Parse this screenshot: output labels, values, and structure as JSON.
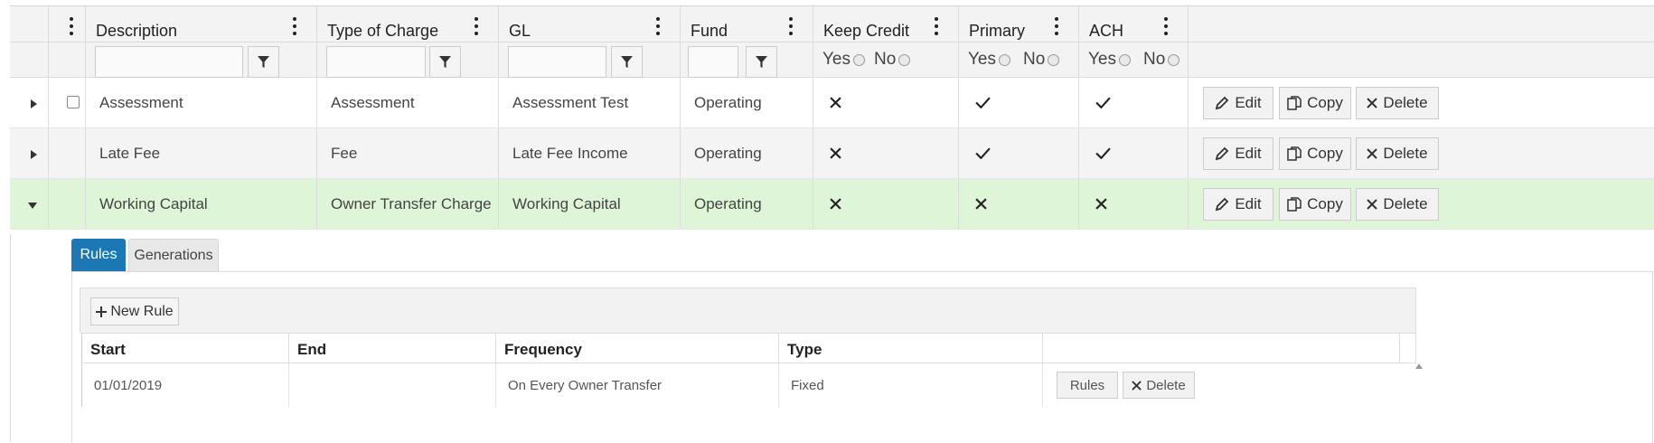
{
  "grid": {
    "headers": {
      "description": "Description",
      "type_of_charge": "Type of Charge",
      "gl": "GL",
      "fund": "Fund",
      "keep_credit": "Keep Credit",
      "primary": "Primary",
      "ach": "ACH"
    },
    "filters": {
      "yes_label": "Yes",
      "no_label": "No"
    },
    "rows": [
      {
        "description": "Assessment",
        "type_of_charge": "Assessment",
        "gl": "Assessment Test",
        "fund": "Operating",
        "keep_credit": "cross-icon",
        "primary": "check-icon",
        "ach": "check-icon",
        "expanded": false,
        "has_checkbox": true
      },
      {
        "description": "Late Fee",
        "type_of_charge": "Fee",
        "gl": "Late Fee Income",
        "fund": "Operating",
        "keep_credit": "cross-icon",
        "primary": "check-icon",
        "ach": "check-icon",
        "expanded": false,
        "has_checkbox": false
      },
      {
        "description": "Working Capital",
        "type_of_charge": "Owner Transfer Charge",
        "gl": "Working Capital",
        "fund": "Operating",
        "keep_credit": "cross-icon",
        "primary": "cross-icon",
        "ach": "cross-icon",
        "expanded": true,
        "has_checkbox": false
      }
    ],
    "actions": {
      "edit": "Edit",
      "copy": "Copy",
      "delete": "Delete"
    }
  },
  "detail": {
    "tabs": [
      {
        "label": "Rules",
        "active": true
      },
      {
        "label": "Generations",
        "active": false
      }
    ],
    "new_rule_label": "New Rule",
    "rules_table": {
      "headers": {
        "start": "Start",
        "end": "End",
        "frequency": "Frequency",
        "type": "Type"
      },
      "rows": [
        {
          "start": "01/01/2019",
          "end": "",
          "frequency": "On Every Owner Transfer",
          "type": "Fixed",
          "rules_button": "Rules",
          "delete_button": "Delete"
        }
      ]
    }
  },
  "colors": {
    "header_bg": "#f3f3f3",
    "selected_row_bg": "#dff5d8",
    "alt_row_bg": "#f4f4f4",
    "tab_active_bg": "#1c77b5"
  }
}
